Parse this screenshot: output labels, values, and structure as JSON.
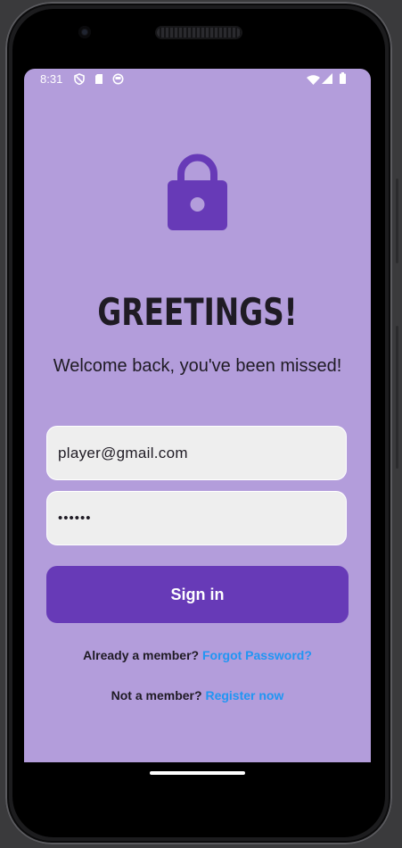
{
  "status_bar": {
    "time": "8:31",
    "left_icons": [
      "shield-icon",
      "sd-card-icon",
      "notification-icon"
    ],
    "right_icons": [
      "wifi-icon",
      "signal-icon",
      "battery-icon"
    ]
  },
  "header": {
    "icon": "lock-icon",
    "title": "GREETINGS!",
    "subtitle": "Welcome back, you've been missed!"
  },
  "form": {
    "email_value": "player@gmail.com",
    "password_value": "••••••",
    "signin_label": "Sign in"
  },
  "links": {
    "forgot_prefix": "Already a member?",
    "forgot_label": "Forgot Password?",
    "register_prefix": "Not a member?",
    "register_label": "Register now"
  },
  "colors": {
    "background": "#b39ddb",
    "primary": "#673ab7",
    "link": "#2196f3",
    "field": "#eeeeee"
  }
}
